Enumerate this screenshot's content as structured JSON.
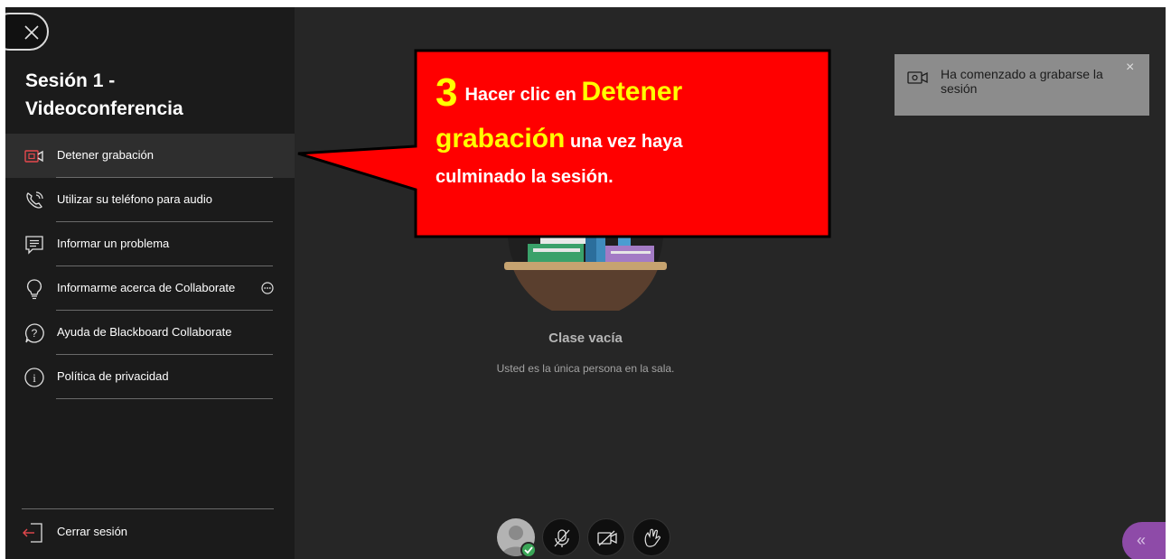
{
  "sidebar": {
    "title_line1": "Sesión 1 -",
    "title_line2": "Videoconferencia",
    "items": [
      {
        "label": "Detener grabación",
        "icon": "record-icon"
      },
      {
        "label": "Utilizar su teléfono para audio",
        "icon": "phone-icon"
      },
      {
        "label": "Informar un problema",
        "icon": "report-icon"
      },
      {
        "label": "Informarme acerca de Collaborate",
        "icon": "lightbulb-icon"
      },
      {
        "label": "Ayuda de Blackboard Collaborate",
        "icon": "help-icon"
      },
      {
        "label": "Política de privacidad",
        "icon": "info-icon"
      }
    ],
    "logout_label": "Cerrar sesión"
  },
  "stage": {
    "empty_title": "Clase vacía",
    "empty_subtitle": "Usted es la única persona en la sala."
  },
  "callout": {
    "number": "3",
    "text1": "Hacer clic en",
    "highlight1": "Detener",
    "highlight2": "grabación",
    "text2": "una vez haya",
    "text3": "culminado la sesión.",
    "fill_color": "#ff0000",
    "highlight_color": "#ffff00"
  },
  "notification": {
    "message": "Ha comenzado a grabarse la sesión",
    "close": "×"
  },
  "controls": {
    "panel_toggle": "«"
  },
  "colors": {
    "background": "#262626",
    "sidebar": "#1b1b1b",
    "accent_purple": "#8e4ba8",
    "status_green": "#3aa657"
  }
}
